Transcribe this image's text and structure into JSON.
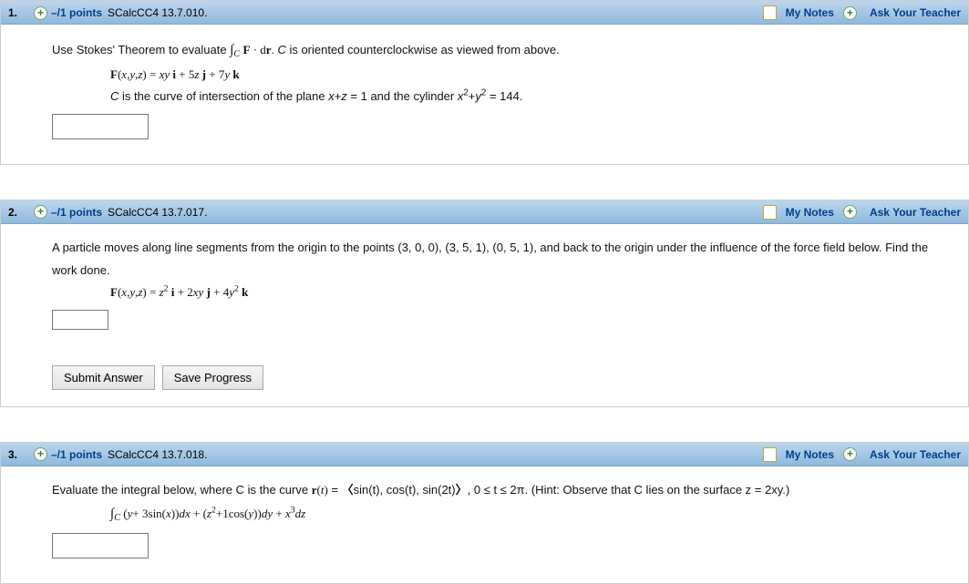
{
  "common": {
    "mynotes": "My Notes",
    "ask": "Ask Your Teacher",
    "submit": "Submit Answer",
    "save": "Save Progress",
    "points": "–/1 points"
  },
  "q1": {
    "num": "1.",
    "id": "SCalcCC4 13.7.010.",
    "line1_pre": "Use Stokes' Theorem to evaluate ",
    "line1_post": " is oriented counterclockwise as viewed from above.",
    "fdef": "F(x,y,z) = xy i + 5z j + 7y k",
    "curve_pre": "C is the curve of intersection of the plane x+z = 1 and the cylinder ",
    "curve_post": " = 144."
  },
  "q2": {
    "num": "2.",
    "id": "SCalcCC4 13.7.017.",
    "prompt": "A particle moves along line segments from the origin to the points (3, 0, 0), (3, 5, 1), (0, 5, 1), and back to the origin under the influence of the force field below. Find the work done."
  },
  "q3": {
    "num": "3.",
    "id": "SCalcCC4 13.7.018.",
    "prompt_pre": "Evaluate the integral below, where C is the curve ",
    "prompt_mid1": " = ",
    "prompt_mid2": "sin(t), cos(t), sin(2t)",
    "prompt_mid3": ", 0 ≤ t ≤ 2π. (Hint: Observe that C lies on the surface z = 2xy.)"
  }
}
